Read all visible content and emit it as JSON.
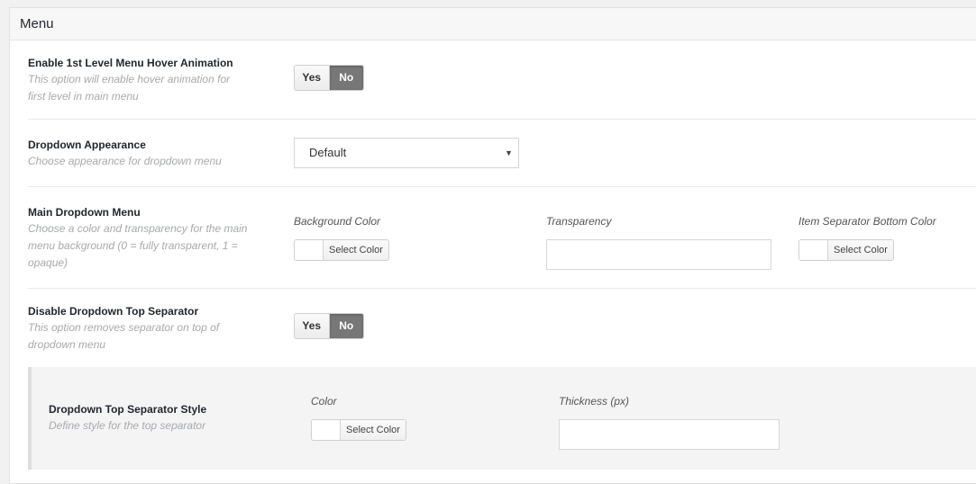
{
  "panel": {
    "title": "Menu"
  },
  "options": {
    "hover_animation": {
      "title": "Enable 1st Level Menu Hover Animation",
      "desc_line1": "This option will enable hover animation for",
      "desc_line2": "first level in main menu",
      "yes": "Yes",
      "no": "No",
      "selected": "No"
    },
    "dropdown_appearance": {
      "title": "Dropdown Appearance",
      "desc": "Choose appearance for dropdown menu",
      "value": "Default",
      "caret": "▼"
    },
    "main_dropdown": {
      "title": "Main Dropdown Menu",
      "desc_line1": "Choose a color and transparency for the main",
      "desc_line2": "menu background (0 = fully transparent, 1 =",
      "desc_line3": "opaque)",
      "bg_label": "Background Color",
      "bg_button": "Select Color",
      "transparency_label": "Transparency",
      "transparency_value": "",
      "sep_label": "Item Separator Bottom Color",
      "sep_button": "Select Color"
    },
    "disable_top_separator": {
      "title": "Disable Dropdown Top Separator",
      "desc_line1": "This option removes separator on top of",
      "desc_line2": "dropdown menu",
      "yes": "Yes",
      "no": "No",
      "selected": "No"
    },
    "top_separator_style": {
      "title": "Dropdown Top Separator Style",
      "desc": "Define style for the top separator",
      "color_label": "Color",
      "color_button": "Select Color",
      "thickness_label": "Thickness (px)",
      "thickness_value": ""
    }
  },
  "colors": {
    "toggle_active": "#777777",
    "sub_section_bg": "#f4f4f5",
    "description_text": "#a7a9ab"
  }
}
